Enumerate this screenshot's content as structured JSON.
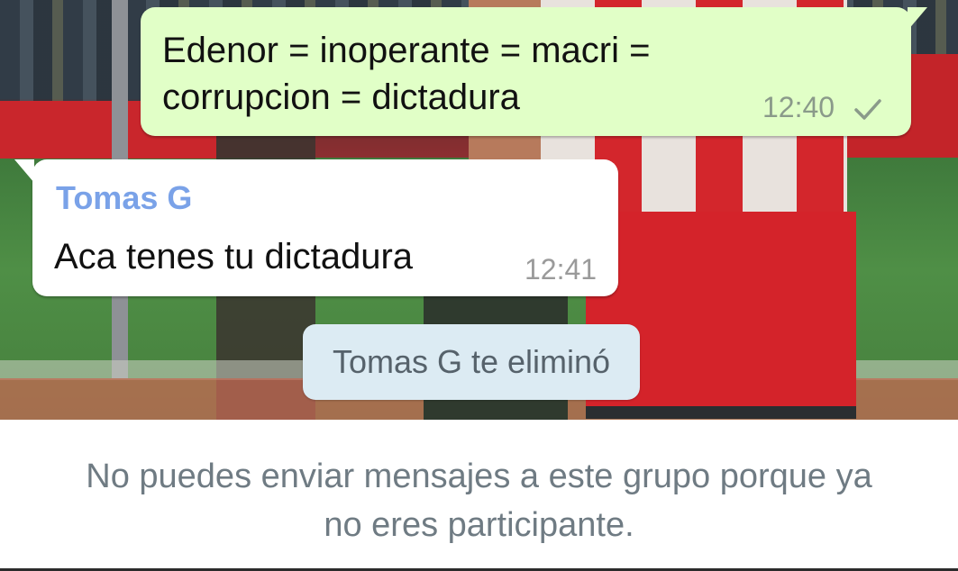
{
  "chat": {
    "messages": [
      {
        "direction": "outgoing",
        "lines": [
          "Edenor = inoperante = macri =",
          "corrupcion = dictadura"
        ],
        "time": "12:40",
        "status_icon": "single-check-icon"
      },
      {
        "direction": "incoming",
        "sender": "Tomas G",
        "lines": [
          "Aca tenes tu dictadura"
        ],
        "time": "12:41"
      }
    ],
    "system_notice": "Tomas G te eliminó"
  },
  "footer": {
    "lines": [
      "No puedes enviar mensajes a este grupo porque ya",
      "no eres participante."
    ]
  },
  "colors": {
    "outgoing_bubble": "#e1ffc7",
    "incoming_bubble": "#ffffff",
    "sender_name": "#7aa2e8",
    "system_pill": "#dcebf3",
    "footer_text": "#6f7b83"
  }
}
